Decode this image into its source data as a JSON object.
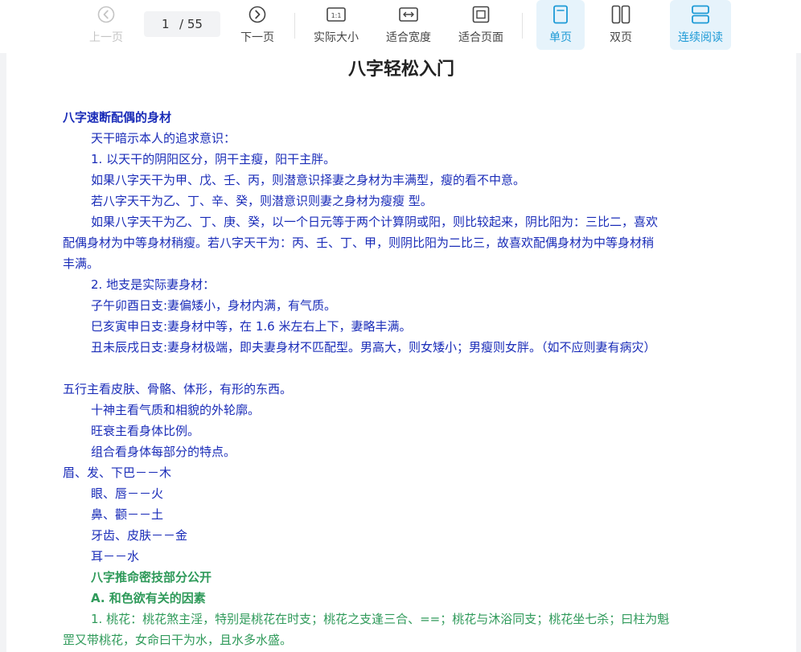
{
  "toolbar": {
    "prev_label": "上一页",
    "page_current": "1",
    "page_total": "/ 55",
    "next_label": "下一页",
    "actual_size_label": "实际大小",
    "actual_size_icon_text": "1:1",
    "fit_width_label": "适合宽度",
    "fit_page_label": "适合页面",
    "single_page_label": "单页",
    "double_page_label": "双页",
    "continuous_label": "连续阅读",
    "active_color": "#1d9ad6"
  },
  "document": {
    "title": "八字轻松入门",
    "lines": [
      "八字速断配偶的身材",
      "天干暗示本人的追求意识：",
      "1. 以天干的阴阳区分，阴干主瘦，阳干主胖。",
      "如果八字天干为甲、戊、壬、丙，则潜意识择妻之身材为丰满型，瘦的看不中意。",
      "若八字天干为乙、丁、辛、癸，则潜意识则妻之身材为瘦瘦 型。",
      "如果八字天干为乙、丁、庚、癸，以一个日元等于两个计算阴或阳，则比较起来，阴比阳为：三比二，喜欢",
      "配偶身材为中等身材稍瘦。若八字天干为：丙、壬、丁、甲，则阴比阳为二比三，故喜欢配偶身材为中等身材稍",
      "丰满。",
      "2. 地支是实际妻身材：",
      "子午卯酉日支:妻偏矮小，身材内满，有气质。",
      "巳亥寅申日支:妻身材中等，在 1.6 米左右上下，妻略丰满。",
      "丑未辰戌日支:妻身材极端，即夫妻身材不匹配型。男高大，则女矮小；男瘦则女胖。（如不应则妻有病灾）",
      "五行主看皮肤、骨骼、体形，有形的东西。",
      "十神主看气质和相貌的外轮廓。",
      "旺衰主看身体比例。",
      "组合看身体每部分的特点。",
      "眉、发、下巴－－木",
      "眼、唇－－火",
      "鼻、颧－－土",
      "牙齿、皮肤－－金",
      "耳－－水",
      "八字推命密技部分公开",
      "A. 和色欲有关的因素",
      "1. 桃花：桃花煞主淫，特别是桃花在时支；桃花之支逢三合、==；桃花与沐浴同支；桃花坐七杀；曰柱为魁",
      "罡又带桃花，女命曰干为水，且水多水盛。"
    ]
  },
  "colors": {
    "body_text": "#1a2cb8",
    "section_green": "#2f9a5a"
  }
}
